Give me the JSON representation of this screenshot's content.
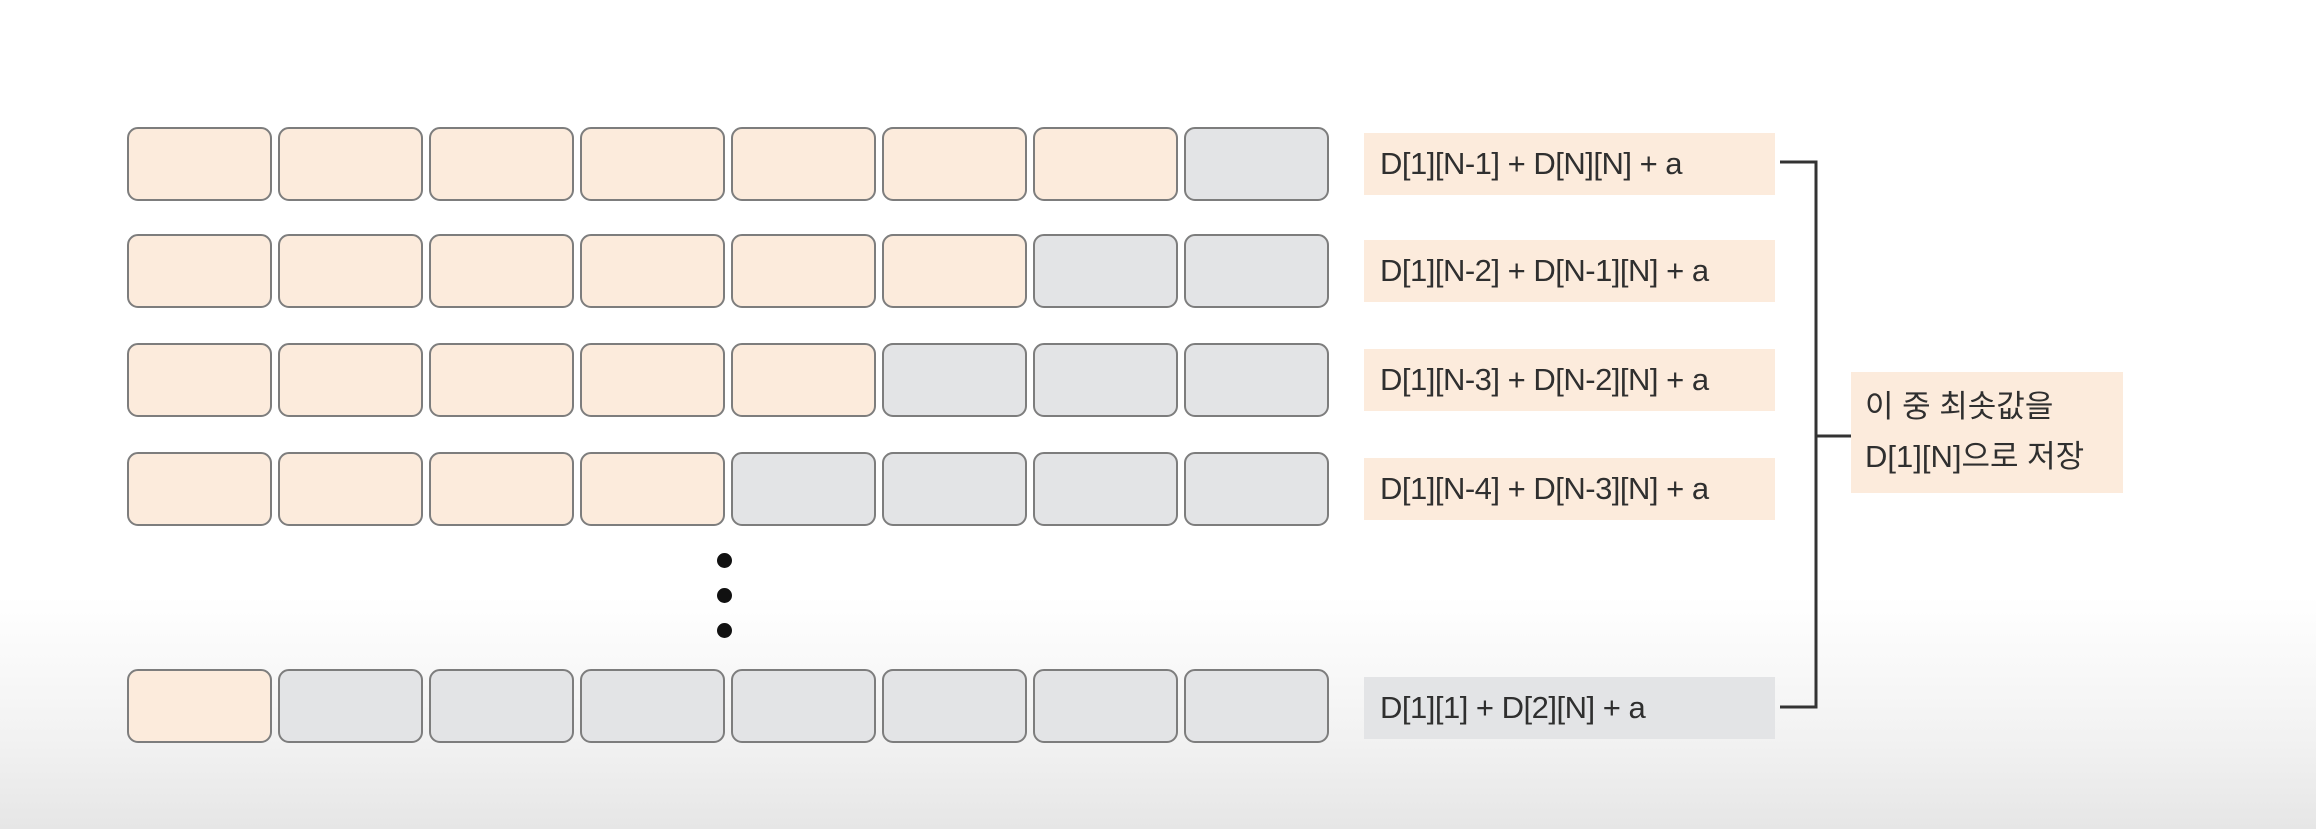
{
  "rows": [
    {
      "filled": 7,
      "total": 8,
      "formula": "D[1][N-1] + D[N][N] + a",
      "formula_bg": "peach"
    },
    {
      "filled": 6,
      "total": 8,
      "formula": "D[1][N-2] + D[N-1][N] + a",
      "formula_bg": "peach"
    },
    {
      "filled": 5,
      "total": 8,
      "formula": "D[1][N-3] + D[N-2][N] + a",
      "formula_bg": "peach"
    },
    {
      "filled": 4,
      "total": 8,
      "formula": "D[1][N-4] + D[N-3][N] + a",
      "formula_bg": "peach"
    },
    {
      "filled": 1,
      "total": 8,
      "formula": "D[1][1] + D[2][N] + a",
      "formula_bg": "gray"
    }
  ],
  "result": {
    "line1": "이 중 최솟값을",
    "line2": "D[1][N]으로 저장"
  },
  "colors": {
    "peach": "#fcebdc",
    "gray": "#e3e4e6",
    "cell_border": "#7d7d7d",
    "bracket": "#333333",
    "dots": "#111111"
  }
}
